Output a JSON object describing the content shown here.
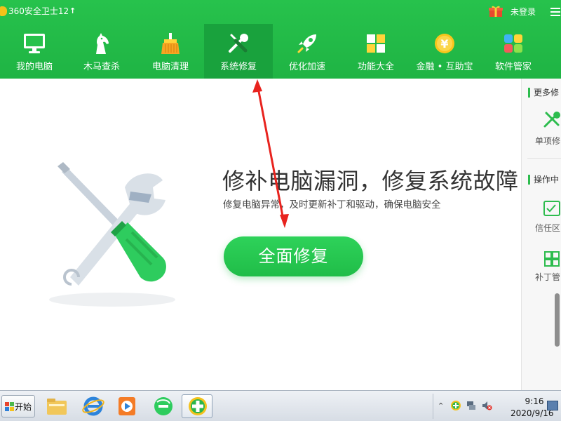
{
  "app": {
    "title": "360安全卫士12",
    "upgrade_icon": "↑",
    "login_label": "未登录"
  },
  "nav": {
    "items": [
      {
        "label": "我的电脑",
        "icon": "computer-icon"
      },
      {
        "label": "木马查杀",
        "icon": "horse-icon"
      },
      {
        "label": "电脑清理",
        "icon": "broom-icon"
      },
      {
        "label": "系统修复",
        "icon": "wrench-screwdriver-icon",
        "active": true
      },
      {
        "label": "优化加速",
        "icon": "rocket-icon"
      },
      {
        "label": "功能大全",
        "icon": "grid-icon"
      },
      {
        "label": "金融 • 互助宝",
        "icon": "yuan-coin-icon"
      },
      {
        "label": "软件管家",
        "icon": "apps-icon"
      }
    ]
  },
  "main": {
    "headline": "修补电脑漏洞，修复系统故障",
    "subline": "修复电脑异常，及时更新补丁和驱动，确保电脑安全",
    "repair_button": "全面修复"
  },
  "sidepanel": {
    "more_title": "更多修",
    "single_item_label": "单项修",
    "ops_title": "操作中",
    "trust_label": "信任区",
    "patch_label": "补丁管"
  },
  "taskbar": {
    "start_label": "开始",
    "clock_time": "9:16",
    "clock_date": "2020/9/16"
  },
  "colors": {
    "brand_green": "#20bd48",
    "active_tab": "#19a23d",
    "arrow_red": "#e8231e"
  }
}
